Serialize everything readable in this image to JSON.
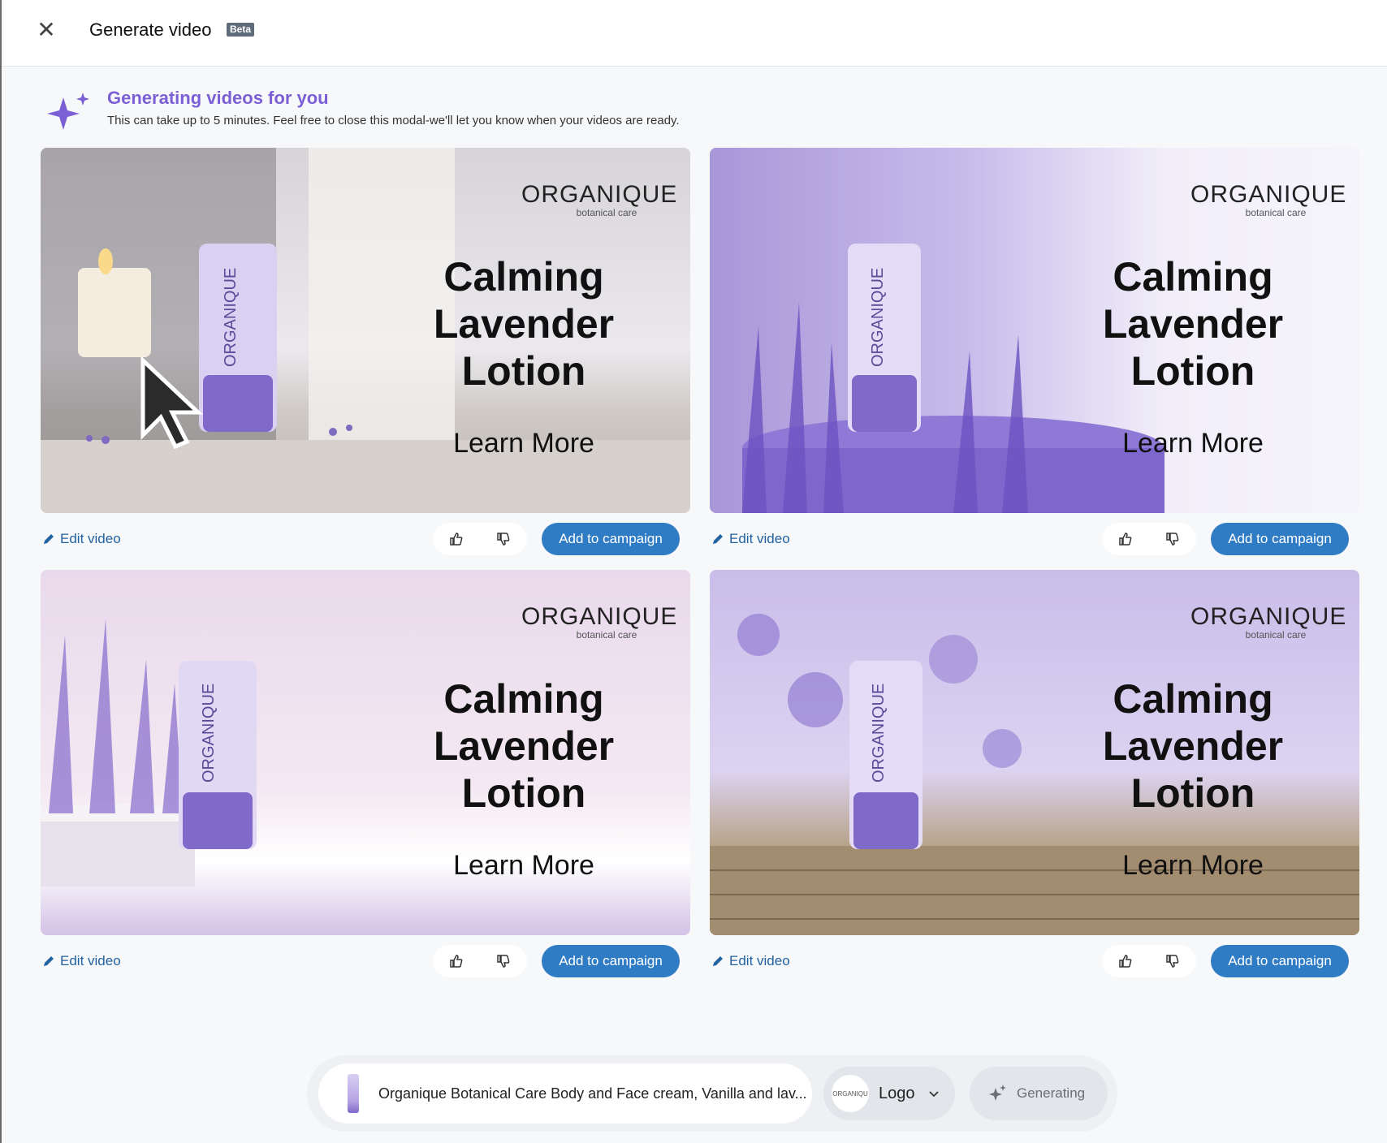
{
  "header": {
    "title": "Generate video",
    "badge": "Beta",
    "close_glyph": "✕"
  },
  "banner": {
    "title": "Generating videos for you",
    "subtitle": "This can take up to 5 minutes. Feel free to close this modal-we'll let you know when your videos are ready.",
    "icon": "sparkle-icon"
  },
  "cards": [
    {
      "brand": "ORGANIQUE",
      "brand_sub": "botanical care",
      "headline": [
        "Calming",
        "Lavender",
        "Lotion"
      ],
      "cta": "Learn More",
      "edit_label": "Edit video",
      "add_label": "Add to campaign"
    },
    {
      "brand": "ORGANIQUE",
      "brand_sub": "botanical care",
      "headline": [
        "Calming",
        "Lavender",
        "Lotion"
      ],
      "cta": "Learn More",
      "edit_label": "Edit video",
      "add_label": "Add to campaign"
    },
    {
      "brand": "ORGANIQUE",
      "brand_sub": "botanical care",
      "headline": [
        "Calming",
        "Lavender",
        "Lotion"
      ],
      "cta": "Learn More",
      "edit_label": "Edit video",
      "add_label": "Add to campaign"
    },
    {
      "brand": "ORGANIQUE",
      "brand_sub": "botanical care",
      "headline": [
        "Calming",
        "Lavender",
        "Lotion"
      ],
      "cta": "Learn More",
      "edit_label": "Edit video",
      "add_label": "Add to campaign"
    }
  ],
  "prompt_bar": {
    "product_text": "Organique Botanical Care Body and Face cream, Vanilla and lav...",
    "logo_avatar_text": "ORGANIQU",
    "logo_label": "Logo",
    "generating_label": "Generating"
  },
  "colors": {
    "accent": "#7b5fd4",
    "primary_button": "#2f7bc4",
    "link": "#2162a1"
  }
}
